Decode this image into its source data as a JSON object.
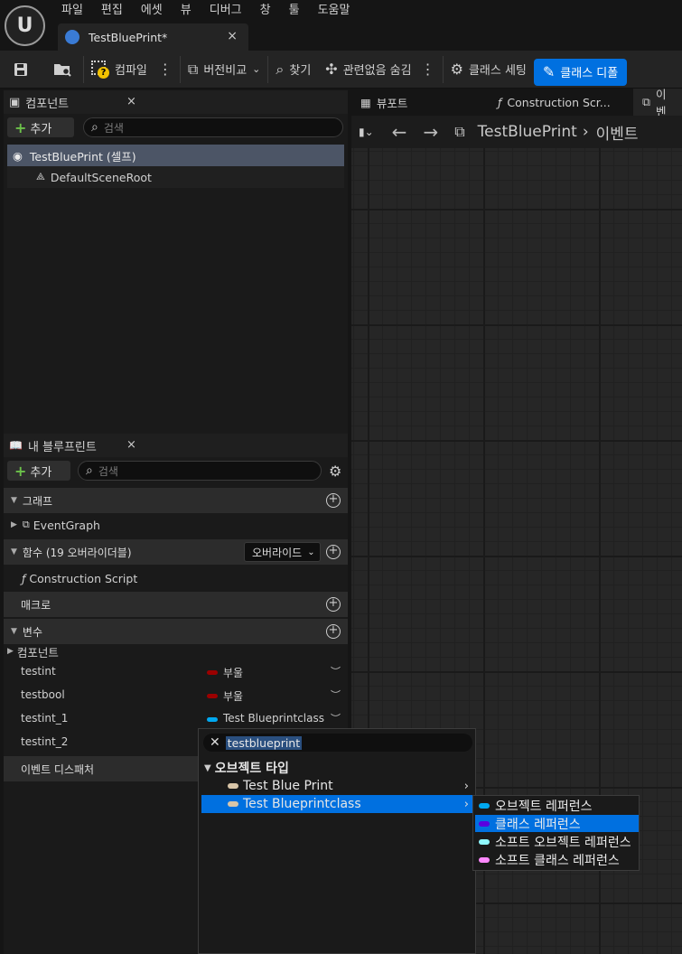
{
  "app": {
    "logo": "U",
    "menu": [
      "파일",
      "편집",
      "에셋",
      "뷰",
      "디버그",
      "창",
      "툴",
      "도움말"
    ],
    "tab_title": "TestBluePrint*",
    "tab_close": "×"
  },
  "toolbar": {
    "compile": "컴파일",
    "diff": "버전비교",
    "find": "찾기",
    "hide_unrelated": "관련없음 숨김",
    "class_settings": "클래스 세팅",
    "class_defaults": "클래스 디폴"
  },
  "components": {
    "title": "컴포넌트",
    "close": "×",
    "add": "추가",
    "search_placeholder": "검색",
    "tree": [
      {
        "label": "TestBluePrint (셀프)"
      },
      {
        "label": "DefaultSceneRoot"
      }
    ]
  },
  "my_blueprint": {
    "title": "내 블루프린트",
    "close": "×",
    "add": "추가",
    "search_placeholder": "검색",
    "graphs_header": "그래프",
    "event_graph": "EventGraph",
    "functions_header": "함수 (19 오버라이더블)",
    "override_label": "오버라이드",
    "construction_script": "Construction Script",
    "macros_header": "매크로",
    "variables_header": "변수",
    "components_category": "컴포넌트",
    "variables": [
      {
        "name": "testint",
        "type": "부울",
        "color": "#9b0000"
      },
      {
        "name": "testbool",
        "type": "부울",
        "color": "#9b0000"
      },
      {
        "name": "testint_1",
        "type": "Test Blueprintclass",
        "color": "#00a8f0"
      },
      {
        "name": "testint_2",
        "type": "",
        "color": ""
      }
    ],
    "dispatchers_header": "이벤트 디스패처"
  },
  "graph": {
    "tabs": [
      {
        "label": "뷰포트"
      },
      {
        "label": "Construction Scr..."
      },
      {
        "label": "이벤"
      }
    ],
    "breadcrumb_root": "TestBluePrint",
    "breadcrumb_current": "이벤트"
  },
  "type_picker": {
    "query": "testblueprint",
    "category": "오브젝트 타입",
    "items": [
      {
        "label": "Test Blue Print"
      },
      {
        "label": "Test Blueprintclass"
      }
    ],
    "submenu": [
      {
        "label": "오브젝트 레퍼런스",
        "color": "#00a8f0"
      },
      {
        "label": "클래스 레퍼런스",
        "color": "#5a00e0"
      },
      {
        "label": "소프트 오브젝트 레퍼런스",
        "color": "#8ff8ff"
      },
      {
        "label": "소프트 클래스 레퍼런스",
        "color": "#ff88ff"
      }
    ]
  },
  "colors": {
    "accent": "#0070e0",
    "selection": "#0a4a9c",
    "bool_pin": "#9b0000",
    "object_pin": "#00a8f0"
  }
}
